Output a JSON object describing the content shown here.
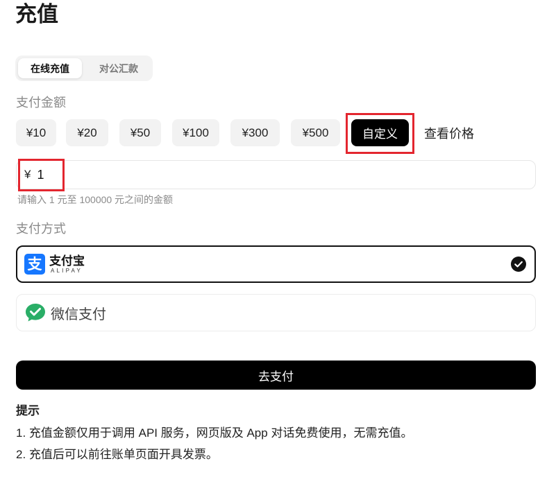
{
  "page": {
    "title": "充值"
  },
  "tabs": [
    {
      "label": "在线充值",
      "active": true
    },
    {
      "label": "对公汇款",
      "active": false
    }
  ],
  "amount": {
    "label": "支付金额",
    "options": [
      {
        "label": "¥10",
        "selected": false
      },
      {
        "label": "¥20",
        "selected": false
      },
      {
        "label": "¥50",
        "selected": false
      },
      {
        "label": "¥100",
        "selected": false
      },
      {
        "label": "¥300",
        "selected": false
      },
      {
        "label": "¥500",
        "selected": false
      },
      {
        "label": "自定义",
        "selected": true
      }
    ],
    "price_link": "查看价格",
    "input": {
      "currency": "¥",
      "value": "1",
      "hint": "请输入 1 元至 100000 元之间的金额"
    }
  },
  "payment": {
    "label": "支付方式",
    "methods": [
      {
        "logo_glyph": "支",
        "name": "支付宝",
        "subname": "ALIPAY",
        "icon": "alipay-logo",
        "selected": true
      },
      {
        "name": "微信支付",
        "icon": "wechat-pay-icon",
        "selected": false
      }
    ]
  },
  "submit": {
    "label": "去支付"
  },
  "tips": {
    "title": "提示",
    "items": [
      "1. 充值金额仅用于调用 API 服务，网页版及 App 对话免费使用，无需充值。",
      "2. 充值后可以前往账单页面开具发票。"
    ]
  },
  "colors": {
    "accent": "#000000",
    "alipay": "#1677ff",
    "wechat": "#2aae67",
    "annotation": "#e3262f",
    "chip_bg": "#f2f2f2"
  }
}
